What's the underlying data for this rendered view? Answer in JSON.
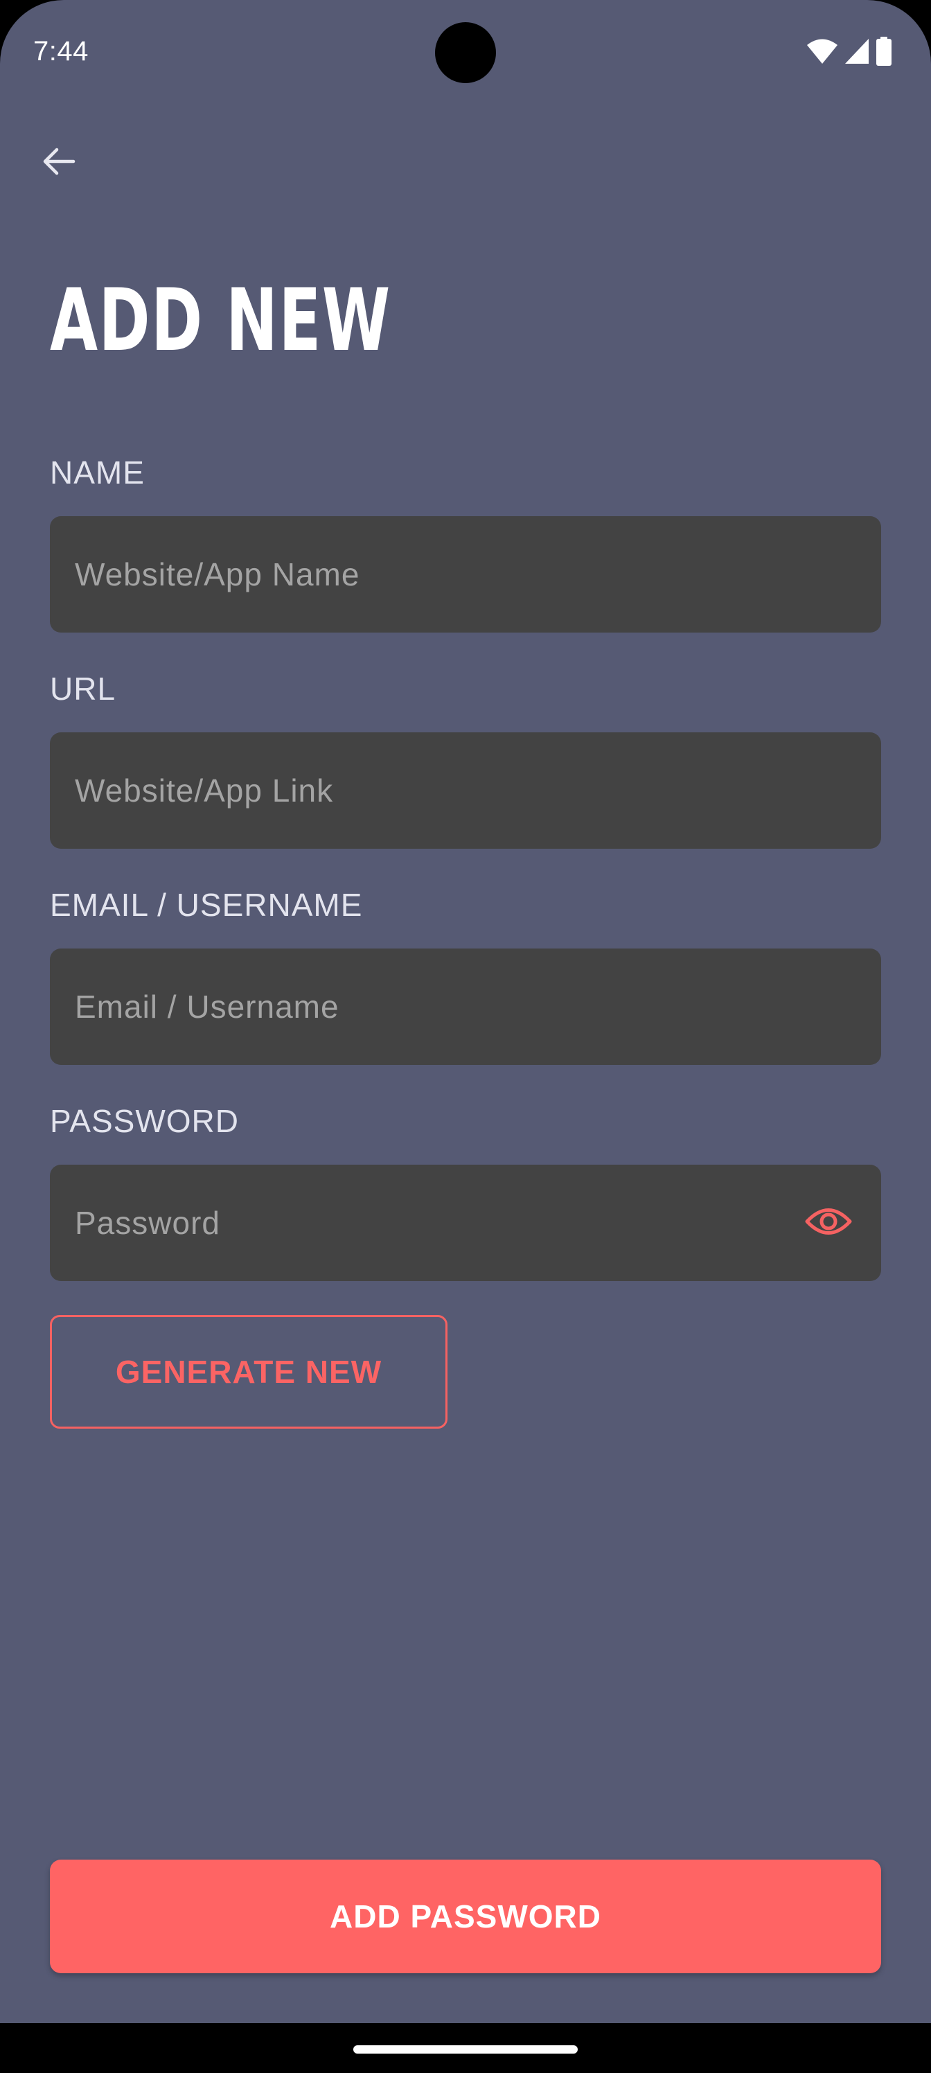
{
  "status_bar": {
    "time": "7:44",
    "icons": [
      "wifi-icon",
      "cellular-signal-icon",
      "battery-icon"
    ]
  },
  "header": {
    "back_icon": "arrow-left-icon",
    "title": "ADD NEW"
  },
  "form": {
    "name": {
      "label": "NAME",
      "value": "",
      "placeholder": "Website/App Name"
    },
    "url": {
      "label": "URL",
      "value": "",
      "placeholder": "Website/App Link"
    },
    "username": {
      "label": "EMAIL / USERNAME",
      "value": "",
      "placeholder": "Email / Username"
    },
    "password": {
      "label": "PASSWORD",
      "value": "",
      "placeholder": "Password",
      "toggle_icon": "eye-icon"
    },
    "generate_label": "GENERATE NEW"
  },
  "actions": {
    "submit_label": "ADD PASSWORD"
  },
  "colors": {
    "background": "#565a74",
    "field_background": "#434343",
    "accent": "#ff6464",
    "label_text": "#e3e4ee",
    "placeholder_text": "#a4a4a4"
  }
}
